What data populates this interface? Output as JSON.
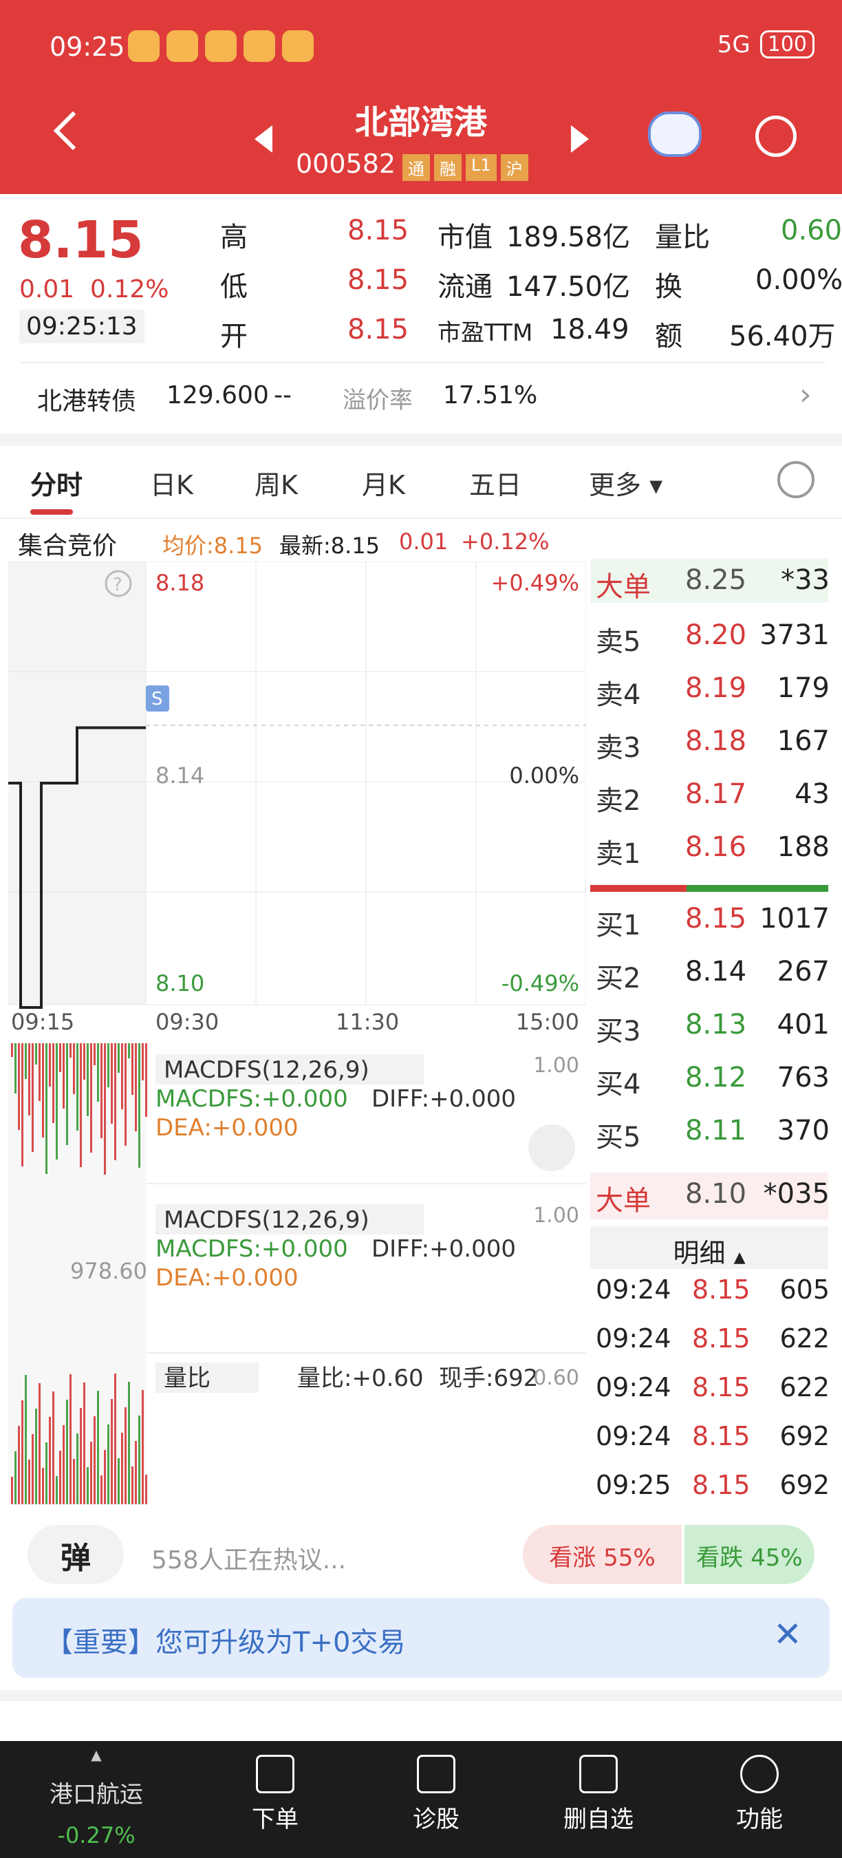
{
  "status_bar": {
    "time": "09:25",
    "network": "5G",
    "battery": "100"
  },
  "header": {
    "title": "北部湾港",
    "code": "000582",
    "tags": [
      "通",
      "融",
      "L1",
      "沪"
    ]
  },
  "quote": {
    "price": "8.15",
    "change": "0.01",
    "change_pct": "0.12%",
    "time": "09:25:13",
    "rows": [
      {
        "l1": "高",
        "v1": "8.15",
        "l2": "市值",
        "v2": "189.58亿",
        "l3": "量比",
        "v3": "0.60"
      },
      {
        "l1": "低",
        "v1": "8.15",
        "l2": "流通",
        "v2": "147.50亿",
        "l3": "换",
        "v3": "0.00%"
      },
      {
        "l1": "开",
        "v1": "8.15",
        "l2": "市盈TTM",
        "v2": "18.49",
        "l3": "额",
        "v3": "56.40万"
      }
    ]
  },
  "bond": {
    "name": "北港转债",
    "price": "129.600",
    "change": "--",
    "premium_label": "溢价率",
    "premium": "17.51%"
  },
  "tabs": [
    "分时",
    "日K",
    "周K",
    "月K",
    "五日",
    "更多"
  ],
  "chart_header": {
    "label": "集合竞价",
    "avg": "均价:8.15",
    "latest": "最新:8.15",
    "chg": "0.01",
    "pct": "+0.12%"
  },
  "chart_data": {
    "type": "line",
    "x": [
      "09:15",
      "09:30",
      "11:30",
      "15:00"
    ],
    "y_ticks_left": [
      "8.18",
      "8.14",
      "8.10"
    ],
    "y_ticks_right": [
      "+0.49%",
      "0.00%",
      "-0.49%"
    ],
    "series": [
      {
        "values": [
          8.14,
          8.14,
          8.1,
          8.1,
          8.14,
          8.14,
          8.15,
          8.15
        ]
      }
    ],
    "ylim": [
      8.1,
      8.18
    ]
  },
  "indicators": [
    {
      "name": "MACDFS(12,26,9)",
      "macdfs": "MACDFS:+0.000",
      "diff": "DIFF:+0.000",
      "dea": "DEA:+0.000",
      "max": "1.00"
    },
    {
      "name": "MACDFS(12,26,9)",
      "macdfs": "MACDFS:+0.000",
      "diff": "DIFF:+0.000",
      "dea": "DEA:+0.000",
      "max": "1.00"
    },
    {
      "name": "量比",
      "value": "量比:+0.60",
      "hand": "现手:692",
      "max": "0.60"
    }
  ],
  "vol_label": "978.60",
  "orderbook": {
    "big_top": {
      "label": "大单",
      "price": "8.25",
      "qty": "*33"
    },
    "sells": [
      {
        "l": "卖5",
        "p": "8.20",
        "q": "3731"
      },
      {
        "l": "卖4",
        "p": "8.19",
        "q": "179"
      },
      {
        "l": "卖3",
        "p": "8.18",
        "q": "167"
      },
      {
        "l": "卖2",
        "p": "8.17",
        "q": "43"
      },
      {
        "l": "卖1",
        "p": "8.16",
        "q": "188"
      }
    ],
    "buys": [
      {
        "l": "买1",
        "p": "8.15",
        "q": "1017"
      },
      {
        "l": "买2",
        "p": "8.14",
        "q": "267"
      },
      {
        "l": "买3",
        "p": "8.13",
        "q": "401"
      },
      {
        "l": "买4",
        "p": "8.12",
        "q": "763"
      },
      {
        "l": "买5",
        "p": "8.11",
        "q": "370"
      }
    ],
    "big_bottom": {
      "label": "大单",
      "price": "8.10",
      "qty": "*035"
    },
    "detail_label": "明细",
    "ticks": [
      {
        "t": "09:24",
        "p": "8.15",
        "q": "605"
      },
      {
        "t": "09:24",
        "p": "8.15",
        "q": "622"
      },
      {
        "t": "09:24",
        "p": "8.15",
        "q": "622"
      },
      {
        "t": "09:24",
        "p": "8.15",
        "q": "692"
      },
      {
        "t": "09:25",
        "p": "8.15",
        "q": "692"
      }
    ]
  },
  "social": {
    "danmu": "弹",
    "discuss": "558人正在热议...",
    "up": "看涨 55%",
    "down": "看跌 45%",
    "up_pct": 55
  },
  "notice": "【重要】您可升级为T+0交易",
  "bottom_nav": {
    "sector": "港口航运",
    "sector_chg": "-0.27%",
    "items": [
      "下单",
      "诊股",
      "删自选",
      "功能"
    ]
  }
}
